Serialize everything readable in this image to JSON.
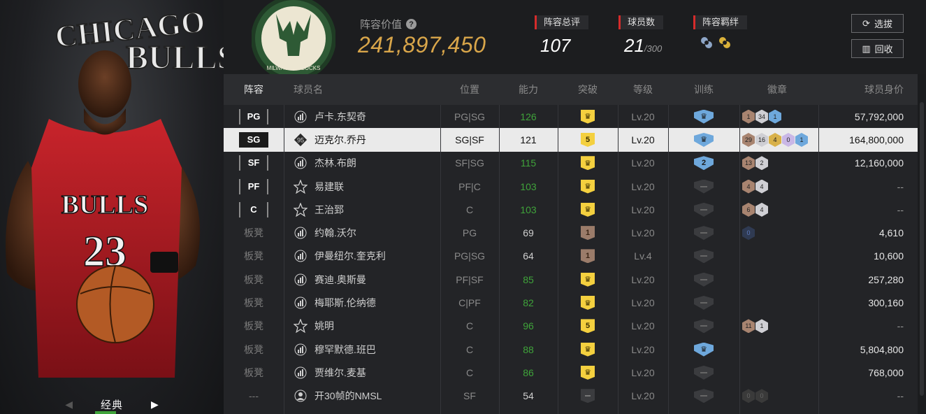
{
  "left": {
    "team_wordmark": "CHICAGO BULLS",
    "card_name": "经典",
    "jersey_team": "BULLS",
    "jersey_number": "23"
  },
  "header": {
    "team_logo": "MILWAUKEE BUCKS",
    "value_label": "阵容价值",
    "value": "241,897,450",
    "rating_label": "阵容总评",
    "rating": "107",
    "players_label": "球员数",
    "players_count": "21",
    "players_max": "/300",
    "bond_label": "阵容羁绊",
    "select_button": "选拔",
    "recycle_button": "回收"
  },
  "table": {
    "columns": [
      "阵容",
      "球员名",
      "位置",
      "能力",
      "突破",
      "等级",
      "训练",
      "徽章",
      "球员身价"
    ],
    "rows": [
      {
        "slot": "PG",
        "name": "卢卡.东契奇",
        "pos": "PG|SG",
        "ability": "126",
        "green": true,
        "brk": "gold",
        "brk_text": "",
        "level": "Lv.20",
        "train": "blue",
        "train_text": "",
        "badges": [
          [
            "bronze",
            "1"
          ],
          [
            "silver",
            "34"
          ],
          [
            "blue",
            "1"
          ]
        ],
        "price": "57,792,000",
        "icon": "bars"
      },
      {
        "slot": "SG",
        "name": "迈克尔.乔丹",
        "pos": "SG|SF",
        "ability": "121",
        "green": false,
        "brk": "gold",
        "brk_text": "5",
        "level": "Lv.20",
        "train": "blue",
        "train_text": "",
        "badges": [
          [
            "bronze",
            "29"
          ],
          [
            "silver",
            "16"
          ],
          [
            "gold",
            "4"
          ],
          [
            "purple",
            "0"
          ],
          [
            "blue",
            "1"
          ]
        ],
        "price": "164,800,000",
        "icon": "95",
        "selected": true
      },
      {
        "slot": "SF",
        "name": "杰林.布朗",
        "pos": "SF|SG",
        "ability": "115",
        "green": true,
        "brk": "gold",
        "brk_text": "",
        "level": "Lv.20",
        "train": "blue",
        "train_text": "2",
        "badges": [
          [
            "bronze",
            "13"
          ],
          [
            "silver",
            "2"
          ]
        ],
        "price": "12,160,000",
        "icon": "bars"
      },
      {
        "slot": "PF",
        "name": "易建联",
        "pos": "PF|C",
        "ability": "103",
        "green": true,
        "brk": "gold",
        "brk_text": "",
        "level": "Lv.20",
        "train": "grey",
        "train_text": "",
        "badges": [
          [
            "bronze",
            "4"
          ],
          [
            "silver",
            "4"
          ]
        ],
        "price": "--",
        "icon": "star"
      },
      {
        "slot": "C",
        "name": "王治郅",
        "pos": "C",
        "ability": "103",
        "green": true,
        "brk": "gold",
        "brk_text": "",
        "level": "Lv.20",
        "train": "grey",
        "train_text": "",
        "badges": [
          [
            "bronze",
            "6"
          ],
          [
            "silver",
            "4"
          ]
        ],
        "price": "--",
        "icon": "star"
      },
      {
        "slot": "板凳",
        "name": "约翰.沃尔",
        "pos": "PG",
        "ability": "69",
        "green": false,
        "brk": "brown",
        "brk_text": "1",
        "level": "Lv.20",
        "train": "grey",
        "train_text": "",
        "badges": [
          [
            "dark",
            "0"
          ]
        ],
        "price": "4,610",
        "icon": "bars"
      },
      {
        "slot": "板凳",
        "name": "伊曼纽尔.奎克利",
        "pos": "PG|SG",
        "ability": "64",
        "green": false,
        "brk": "brown",
        "brk_text": "1",
        "level": "Lv.4",
        "train": "grey",
        "train_text": "",
        "badges": [],
        "price": "10,600",
        "icon": "bars"
      },
      {
        "slot": "板凳",
        "name": "赛迪.奥斯曼",
        "pos": "PF|SF",
        "ability": "85",
        "green": true,
        "brk": "gold",
        "brk_text": "",
        "level": "Lv.20",
        "train": "grey",
        "train_text": "",
        "badges": [],
        "price": "257,280",
        "icon": "bars"
      },
      {
        "slot": "板凳",
        "name": "梅耶斯.伦纳德",
        "pos": "C|PF",
        "ability": "82",
        "green": true,
        "brk": "gold",
        "brk_text": "",
        "level": "Lv.20",
        "train": "grey",
        "train_text": "",
        "badges": [],
        "price": "300,160",
        "icon": "bars"
      },
      {
        "slot": "板凳",
        "name": "姚明",
        "pos": "C",
        "ability": "96",
        "green": true,
        "brk": "gold",
        "brk_text": "5",
        "level": "Lv.20",
        "train": "grey",
        "train_text": "",
        "badges": [
          [
            "bronze",
            "11"
          ],
          [
            "silver",
            "1"
          ]
        ],
        "price": "--",
        "icon": "star"
      },
      {
        "slot": "板凳",
        "name": "穆罕默德.班巴",
        "pos": "C",
        "ability": "88",
        "green": true,
        "brk": "gold",
        "brk_text": "",
        "level": "Lv.20",
        "train": "blue",
        "train_text": "",
        "badges": [],
        "price": "5,804,800",
        "icon": "bars"
      },
      {
        "slot": "板凳",
        "name": "贾维尔.麦基",
        "pos": "C",
        "ability": "86",
        "green": true,
        "brk": "gold",
        "brk_text": "",
        "level": "Lv.20",
        "train": "grey",
        "train_text": "",
        "badges": [],
        "price": "768,000",
        "icon": "bars"
      },
      {
        "slot": "---",
        "name": "开30帧的NMSL",
        "pos": "SF",
        "ability": "54",
        "green": false,
        "brk": "grey",
        "brk_text": "",
        "level": "Lv.20",
        "train": "grey",
        "train_text": "",
        "badges": [
          [
            "empty",
            "0"
          ],
          [
            "empty",
            "0"
          ]
        ],
        "price": "--",
        "icon": "person"
      }
    ]
  }
}
